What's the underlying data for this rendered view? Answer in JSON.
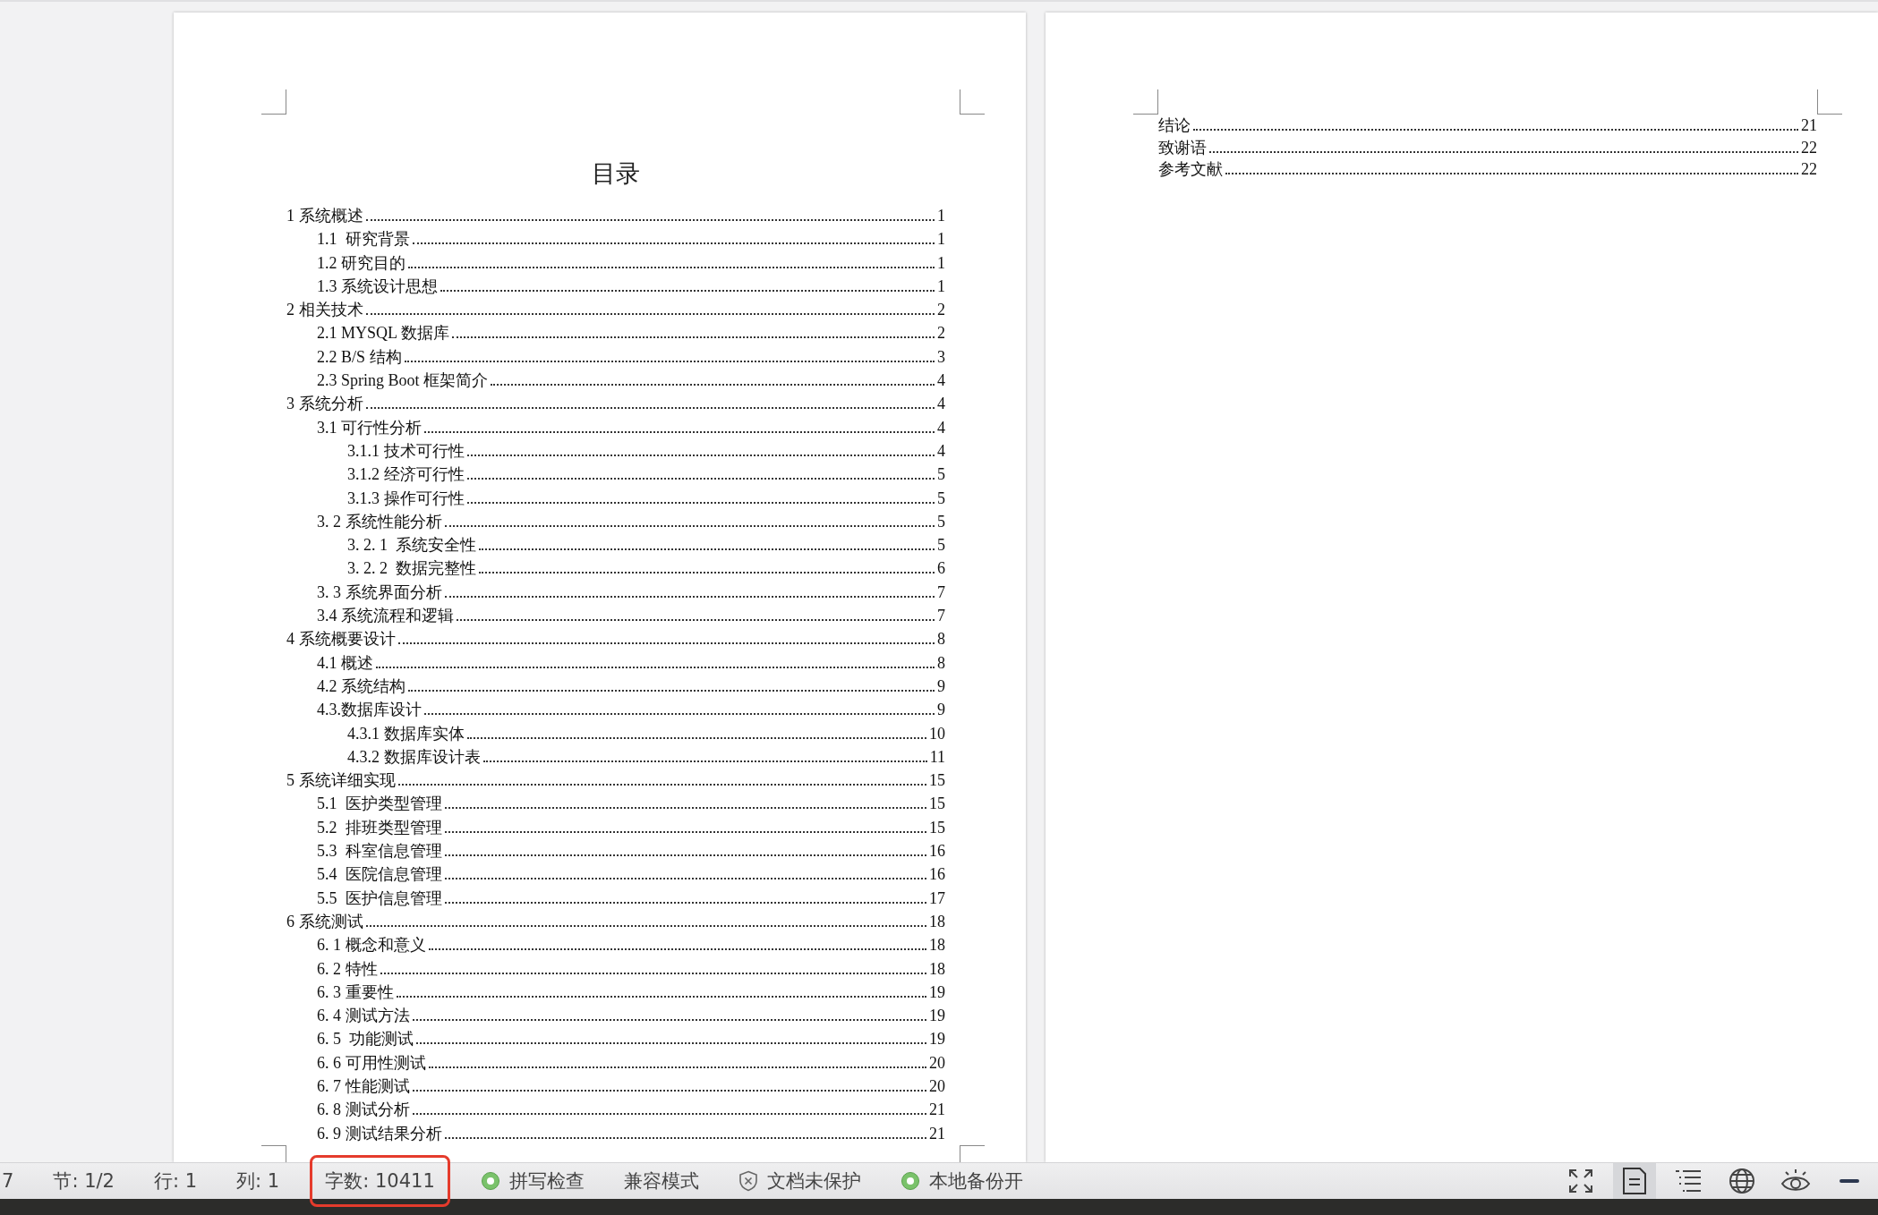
{
  "pages": [
    {
      "heading": "目录",
      "toc": [
        {
          "title": "1 系统概述",
          "page": "1",
          "children": [
            {
              "title": "1.1  研究背景",
              "page": "1"
            },
            {
              "title": "1.2 研究目的",
              "page": "1"
            },
            {
              "title": "1.3 系统设计思想",
              "page": "1"
            }
          ]
        },
        {
          "title": "2 相关技术",
          "page": "2",
          "children": [
            {
              "title": "2.1 MYSQL 数据库",
              "page": "2"
            },
            {
              "title": "2.2 B/S 结构",
              "page": "3"
            },
            {
              "title": "2.3 Spring Boot 框架简介",
              "page": "4"
            }
          ]
        },
        {
          "title": "3 系统分析",
          "page": "4",
          "children": [
            {
              "title": "3.1 可行性分析",
              "page": "4",
              "children": [
                {
                  "title": "3.1.1 技术可行性",
                  "page": "4"
                },
                {
                  "title": "3.1.2 经济可行性",
                  "page": "5"
                },
                {
                  "title": "3.1.3 操作可行性",
                  "page": "5"
                }
              ]
            },
            {
              "title": "3. 2 系统性能分析",
              "page": "5",
              "children": [
                {
                  "title": "3. 2. 1  系统安全性",
                  "page": "5"
                },
                {
                  "title": "3. 2. 2  数据完整性",
                  "page": "6"
                }
              ]
            },
            {
              "title": "3. 3 系统界面分析",
              "page": "7"
            },
            {
              "title": "3.4 系统流程和逻辑",
              "page": "7"
            }
          ]
        },
        {
          "title": "4 系统概要设计",
          "page": "8",
          "children": [
            {
              "title": "4.1 概述",
              "page": "8"
            },
            {
              "title": "4.2 系统结构",
              "page": "9"
            },
            {
              "title": "4.3.数据库设计",
              "page": "9",
              "children": [
                {
                  "title": "4.3.1 数据库实体",
                  "page": "10"
                },
                {
                  "title": "4.3.2 数据库设计表",
                  "page": "11"
                }
              ]
            }
          ]
        },
        {
          "title": "5 系统详细实现",
          "page": "15",
          "children": [
            {
              "title": "5.1  医护类型管理",
              "page": "15"
            },
            {
              "title": "5.2  排班类型管理",
              "page": "15"
            },
            {
              "title": "5.3  科室信息管理",
              "page": "16"
            },
            {
              "title": "5.4  医院信息管理",
              "page": "16"
            },
            {
              "title": "5.5  医护信息管理",
              "page": "17"
            }
          ]
        },
        {
          "title": "6 系统测试",
          "page": "18",
          "children": [
            {
              "title": "6. 1 概念和意义",
              "page": "18"
            },
            {
              "title": "6. 2 特性",
              "page": "18"
            },
            {
              "title": "6. 3 重要性",
              "page": "19"
            },
            {
              "title": "6. 4 测试方法",
              "page": "19"
            },
            {
              "title": "6. 5  功能测试",
              "page": "19"
            },
            {
              "title": "6. 6 可用性测试",
              "page": "20"
            },
            {
              "title": "6. 7 性能测试",
              "page": "20"
            },
            {
              "title": "6. 8 测试分析",
              "page": "21"
            },
            {
              "title": "6. 9 测试结果分析",
              "page": "21"
            }
          ]
        }
      ]
    },
    {
      "toc": [
        {
          "title": "结论",
          "page": "21"
        },
        {
          "title": "致谢语",
          "page": "22"
        },
        {
          "title": "参考文献",
          "page": "22"
        }
      ]
    }
  ],
  "status_bar": {
    "items": [
      {
        "kind": "text",
        "label": "7",
        "highlighted": false
      },
      {
        "kind": "text",
        "label": "节: 1/2",
        "highlighted": false
      },
      {
        "kind": "text",
        "label": "行: 1",
        "highlighted": false
      },
      {
        "kind": "text",
        "label": "列: 1",
        "highlighted": false
      },
      {
        "kind": "text",
        "label": "字数: 10411",
        "highlighted": true
      },
      {
        "kind": "dot",
        "label": "拼写检查",
        "highlighted": false
      },
      {
        "kind": "text",
        "label": "兼容模式",
        "highlighted": false
      },
      {
        "kind": "shield",
        "label": "文档未保护",
        "highlighted": false
      },
      {
        "kind": "dot",
        "label": "本地备份开",
        "highlighted": false
      }
    ],
    "view_buttons": [
      {
        "kind": "fullscreen",
        "selected": false
      },
      {
        "kind": "page",
        "selected": true
      },
      {
        "kind": "outline",
        "selected": false
      },
      {
        "kind": "web",
        "selected": false
      },
      {
        "kind": "reading",
        "selected": false
      },
      {
        "kind": "zoom-out",
        "selected": false
      }
    ]
  }
}
